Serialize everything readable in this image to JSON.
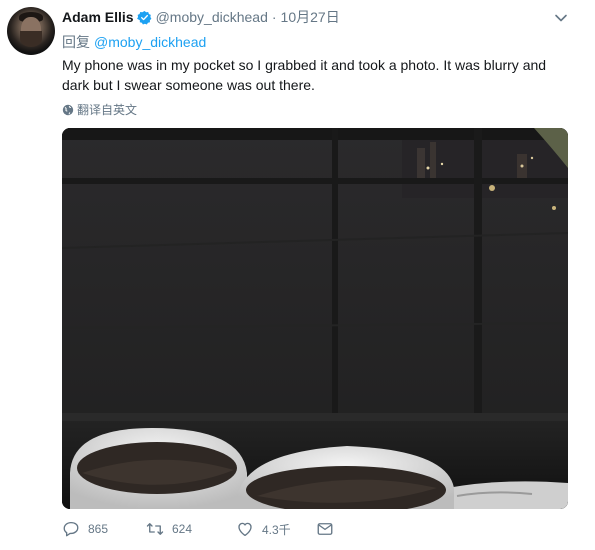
{
  "tweet": {
    "author": {
      "name": "Adam Ellis",
      "handle": "@moby_dickhead",
      "verified": true
    },
    "date_separator": "·",
    "date": "10月27日",
    "reply": {
      "prefix": "回复",
      "to": "@moby_dickhead"
    },
    "text": "My phone was in my pocket so I grabbed it and took a photo. It was blurry and dark but I swear someone was out there.",
    "translate_label": "翻译自英文",
    "actions": {
      "replies": "865",
      "retweets": "624",
      "likes": "4.3千"
    }
  },
  "colors": {
    "link": "#1da1f2",
    "secondary_text": "#657786",
    "primary_text": "#14171a"
  },
  "icons": [
    "verified-badge-icon",
    "chevron-down-icon",
    "globe-icon",
    "reply-icon",
    "retweet-icon",
    "heart-icon",
    "message-icon"
  ]
}
